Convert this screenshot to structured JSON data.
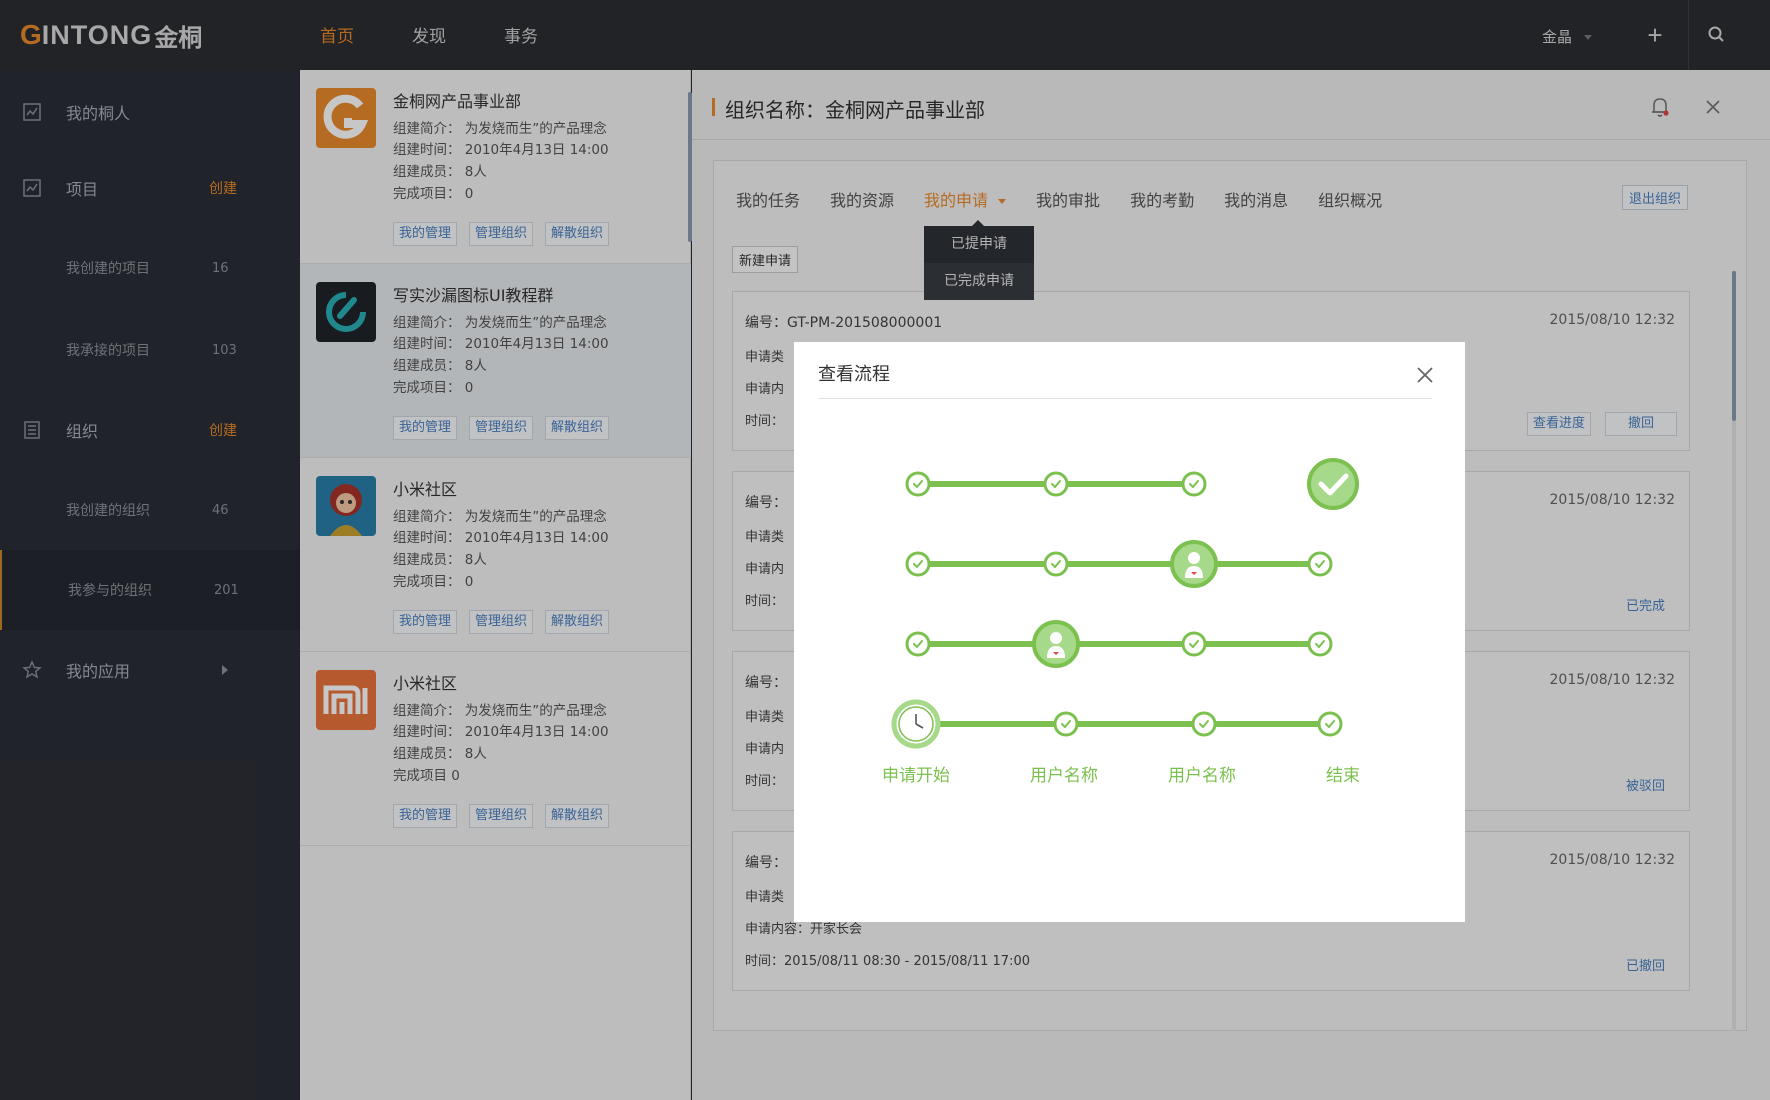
{
  "brand": {
    "logo_g": "G",
    "logo_text": "INTONG",
    "logo_cn": "金桐"
  },
  "topnav": [
    {
      "label": "首页",
      "active": true
    },
    {
      "label": "发现",
      "active": false
    },
    {
      "label": "事务",
      "active": false
    }
  ],
  "user": {
    "name": "金晶"
  },
  "sidebar": {
    "items": [
      {
        "label": "我的桐人",
        "icon": "contacts-icon"
      },
      {
        "label": "项目",
        "action": "创建",
        "icon": "project-icon"
      },
      {
        "label": "我创建的项目",
        "count": "16"
      },
      {
        "label": "我承接的项目",
        "count": "103"
      },
      {
        "label": "组织",
        "action": "创建",
        "icon": "org-icon"
      },
      {
        "label": "我创建的组织",
        "count": "46"
      },
      {
        "label": "我参与的组织",
        "count": "201"
      },
      {
        "label": "我的应用",
        "icon": "star-icon"
      }
    ]
  },
  "orgs": [
    {
      "name": "金桐网产品事业部",
      "intro": "组建简介： 为发烧而生”的产品理念",
      "time": "组建时间： 2010年4月13日  14:00",
      "members": "组建成员： 8人",
      "projects": "完成项目：  0",
      "logo": "gintong"
    },
    {
      "name": "写实沙漏图标UI教程群",
      "intro": "组建简介： 为发烧而生”的产品理念",
      "time": "组建时间： 2010年4月13日  14:00",
      "members": "组建成员： 8人",
      "projects": "完成项目：  0",
      "logo": "hourglass"
    },
    {
      "name": "小米社区",
      "intro": "组建简介： 为发烧而生”的产品理念",
      "time": "组建时间： 2010年4月13日  14:00",
      "members": "组建成员： 8人",
      "projects": "完成项目：  0",
      "logo": "avatar"
    },
    {
      "name": "小米社区",
      "intro": "组建简介： 为发烧而生”的产品理念",
      "time": "组建时间： 2010年4月13日  14:00",
      "members": "组建成员： 8人",
      "projects": "完成项目     0",
      "logo": "mi"
    }
  ],
  "org_buttons": {
    "manage": "我的管理",
    "admin": "管理组织",
    "dissolve": "解散组织"
  },
  "main": {
    "title": "组织名称：金桐网产品事业部",
    "tabs": [
      "我的任务",
      "我的资源",
      "我的申请",
      "我的审批",
      "我的考勤",
      "我的消息",
      "组织概况"
    ],
    "exit_label": "退出组织",
    "dropdown": [
      "已提申请",
      "已完成申请"
    ],
    "new_label": "新建申请"
  },
  "requests": [
    {
      "id": "编号：GT-PM-201508000001",
      "date": "2015/08/10    12:32",
      "type": "申请类",
      "content": "申请内",
      "time": "时间：",
      "actions": [
        "查看进度",
        "撤回"
      ]
    },
    {
      "id": "编号：",
      "date": "2015/08/10    12:32",
      "type": "申请类",
      "content": "申请内",
      "time": "时间：",
      "status": "已完成"
    },
    {
      "id": "编号：",
      "date": "2015/08/10    12:32",
      "type": "申请类",
      "content": "申请内",
      "time": "时间：",
      "status": "被驳回"
    },
    {
      "id": "编号：",
      "date": "2015/08/10    12:32",
      "type": "申请类",
      "content": "申请内容：开家长会",
      "time": "时间：2015/08/11  08:30 - 2015/08/11  17:00",
      "status": "已撤回"
    }
  ],
  "modal": {
    "title": "查看流程",
    "labels": [
      "申请开始",
      "用户名称",
      "用户名称",
      "结束"
    ],
    "accent": "#7cc04f"
  }
}
